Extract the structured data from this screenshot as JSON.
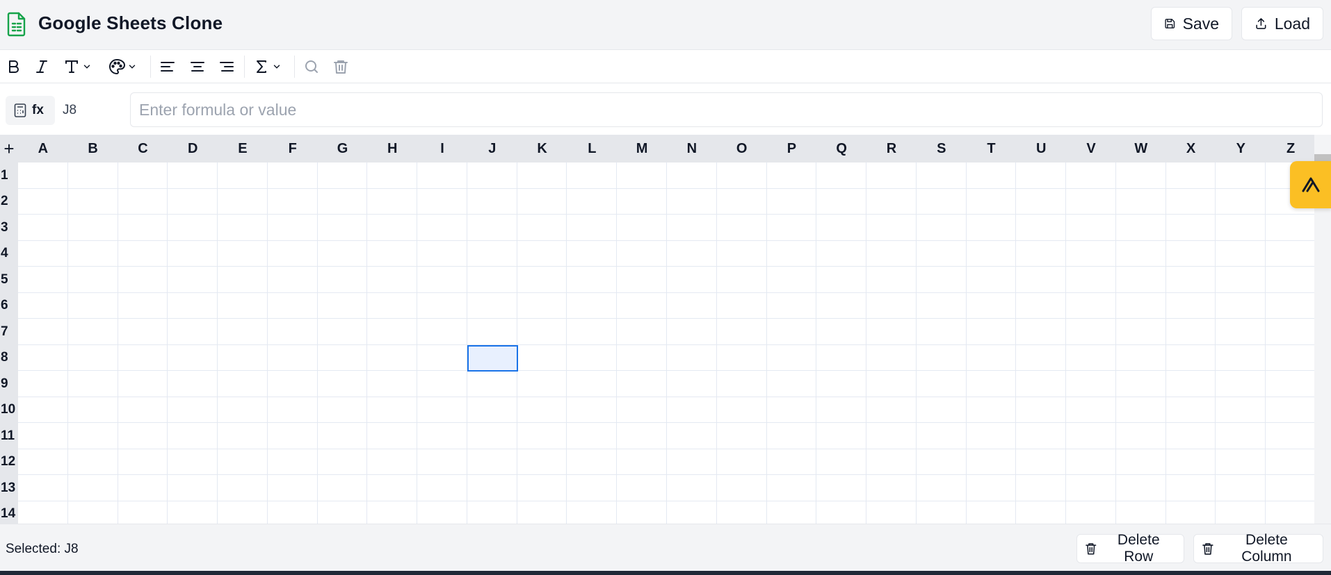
{
  "header": {
    "title": "Google Sheets Clone",
    "save_label": "Save",
    "load_label": "Load",
    "logo_icon": "sheet-file-icon",
    "accent_color": "#16a34a"
  },
  "toolbar": {
    "items": [
      "bold-icon",
      "italic-icon",
      "text-type-icon",
      "palette-icon",
      "align-left-icon",
      "align-center-icon",
      "align-right-icon",
      "sigma-icon",
      "search-icon",
      "trash-icon"
    ]
  },
  "formula_bar": {
    "fx_label": "fx",
    "cell_ref": "J8",
    "placeholder": "Enter formula or value",
    "value": ""
  },
  "grid": {
    "add_label": "+",
    "columns": [
      "A",
      "B",
      "C",
      "D",
      "E",
      "F",
      "G",
      "H",
      "I",
      "J",
      "K",
      "L",
      "M",
      "N",
      "O",
      "P",
      "Q",
      "R",
      "S",
      "T",
      "U",
      "V",
      "W",
      "X",
      "Y",
      "Z"
    ],
    "rows": [
      "1",
      "2",
      "3",
      "4",
      "5",
      "6",
      "7",
      "8",
      "9",
      "10",
      "11",
      "12",
      "13",
      "14"
    ],
    "selected_cell": "J8",
    "selection_color": "#1a73e8"
  },
  "footer": {
    "status": "Selected: J8",
    "delete_row_label": "Delete Row",
    "delete_column_label": "Delete Column"
  }
}
